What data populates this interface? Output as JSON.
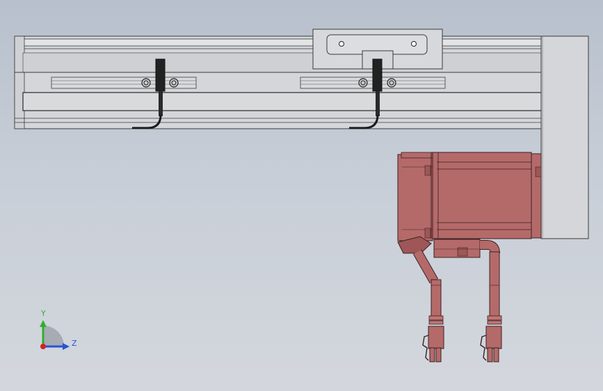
{
  "viewport": {
    "background_top": "#b7c0cc",
    "background_bottom": "#d3d7dd"
  },
  "model": {
    "rail_color": "#d4d6d9",
    "rail_edge_color": "#3a3a3a",
    "motor_color": "#b56a6a",
    "motor_shade_color": "#9e5656",
    "sensor_color": "#222222"
  },
  "triad": {
    "y_label": "Y",
    "z_label": "Z",
    "y_color": "#2fae2f",
    "z_color": "#2a52d8",
    "x_color": "#d02424"
  }
}
